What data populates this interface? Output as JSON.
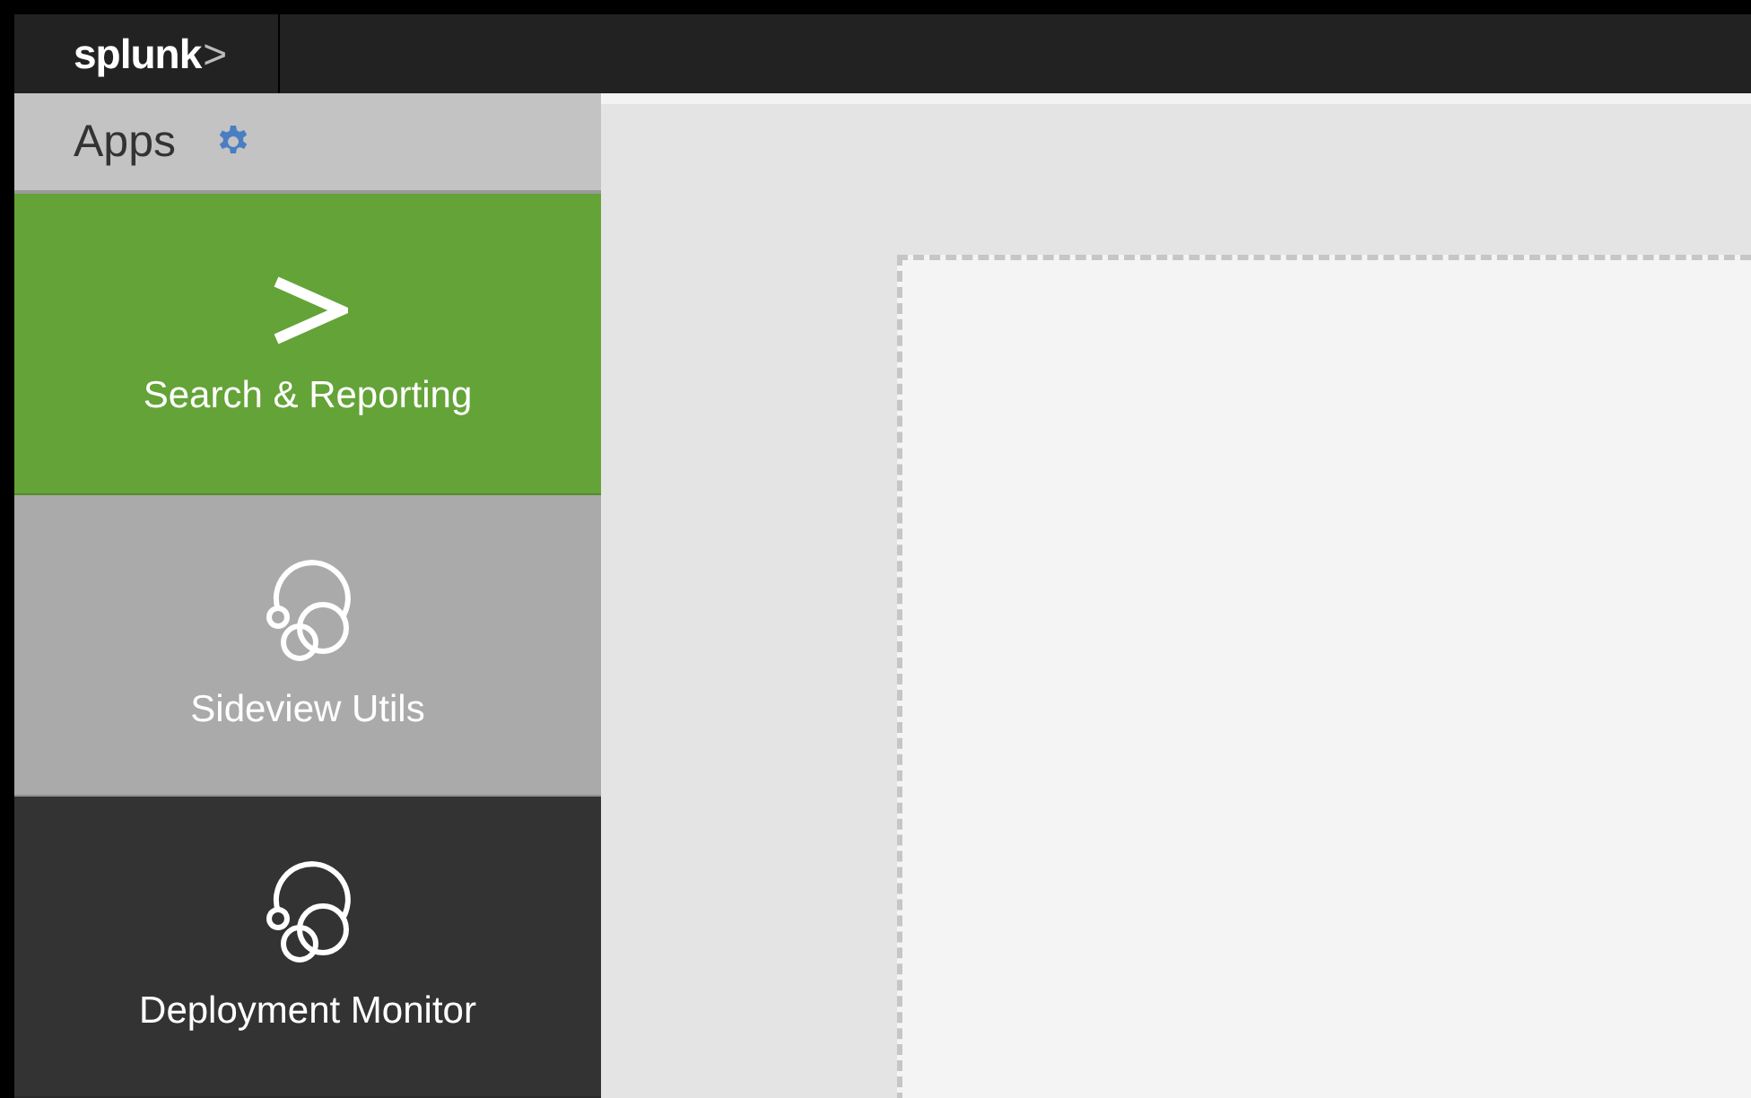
{
  "top_bar": {
    "logo": {
      "word": "splunk",
      "mark": ">"
    }
  },
  "sidebar": {
    "title": "Apps",
    "apps": [
      {
        "label": "Search & Reporting",
        "kind": "search",
        "color": "#64a337"
      },
      {
        "label": "Sideview Utils",
        "kind": "generic",
        "color": "#aaaaaa"
      },
      {
        "label": "Deployment Monitor",
        "kind": "generic",
        "color": "#333333"
      }
    ]
  }
}
